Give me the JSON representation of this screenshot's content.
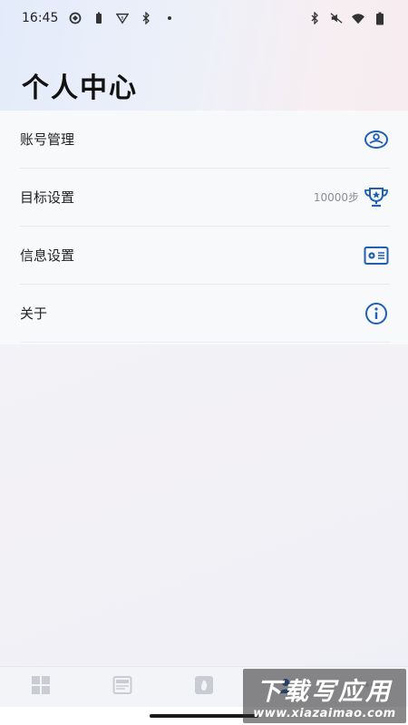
{
  "status_bar": {
    "time": "16:45",
    "left_icons": [
      "sync-icon",
      "battery-saver-icon",
      "vpn-icon",
      "bluetooth-icon",
      "dot-icon"
    ],
    "right_icons": [
      "bluetooth-icon",
      "mute-icon",
      "wifi-icon",
      "battery-icon"
    ]
  },
  "header": {
    "title": "个人中心"
  },
  "menu": {
    "items": [
      {
        "label": "账号管理",
        "value": "",
        "icon": "account-icon"
      },
      {
        "label": "目标设置",
        "value": "10000步",
        "icon": "trophy-icon"
      },
      {
        "label": "信息设置",
        "value": "",
        "icon": "id-card-icon"
      },
      {
        "label": "关于",
        "value": "",
        "icon": "info-icon"
      }
    ]
  },
  "tab_bar": {
    "tabs": [
      {
        "icon": "grid-icon"
      },
      {
        "icon": "news-icon"
      },
      {
        "icon": "fire-icon"
      },
      {
        "icon": "profile-icon"
      },
      {
        "icon": "more-icon"
      }
    ]
  },
  "watermark": {
    "main": "下载写应用",
    "sub": "www.xiazaimao.com"
  },
  "colors": {
    "accent": "#1f5fb6",
    "text": "#222222",
    "muted": "#8a8d93"
  }
}
